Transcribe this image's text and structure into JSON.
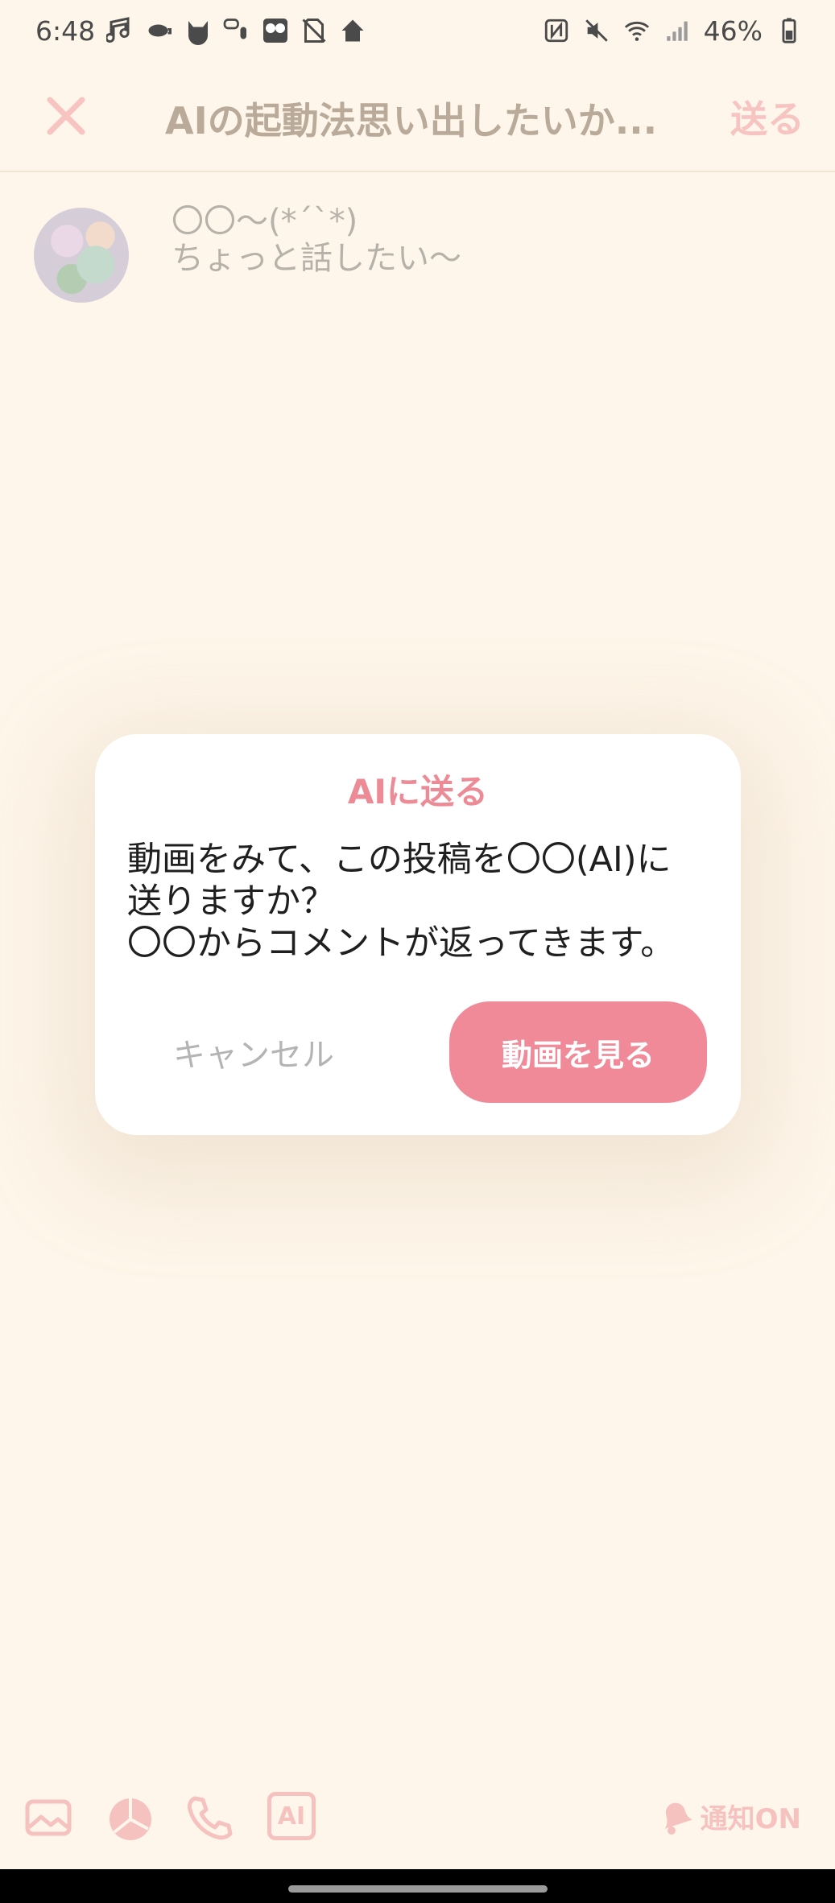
{
  "status_bar": {
    "time": "6:48",
    "battery": "46%",
    "icons": [
      "music-icon",
      "cup-icon",
      "cat-icon",
      "voice-chat-icon",
      "faces-icon",
      "no-sim-icon",
      "home-icon",
      "nfc-icon",
      "mute-icon",
      "wifi-icon",
      "signal-icon",
      "battery-icon"
    ]
  },
  "header": {
    "title": "AIの起動法思い出したいか...",
    "send_label": "送る"
  },
  "post": {
    "line1": "〇〇〜(*´`*)",
    "line2": "ちょっと話したい〜"
  },
  "dialog": {
    "title": "AIに送る",
    "message_line1": "動画をみて、この投稿を〇〇(AI)に",
    "message_line2": "送りますか？",
    "message_line3": "〇〇からコメントが返ってきます。",
    "cancel_label": "キャンセル",
    "confirm_label": "動画を見る"
  },
  "toolbar": {
    "ai_label": "AI",
    "notify_label": "通知ON",
    "icons": [
      "image-icon",
      "chart-icon",
      "phone-icon",
      "ai-icon",
      "bell-icon"
    ]
  },
  "colors": {
    "background": "#fef6ea",
    "accent": "#f08a99",
    "accent_light": "#f7c4c2",
    "title_pink": "#ec8a95"
  }
}
